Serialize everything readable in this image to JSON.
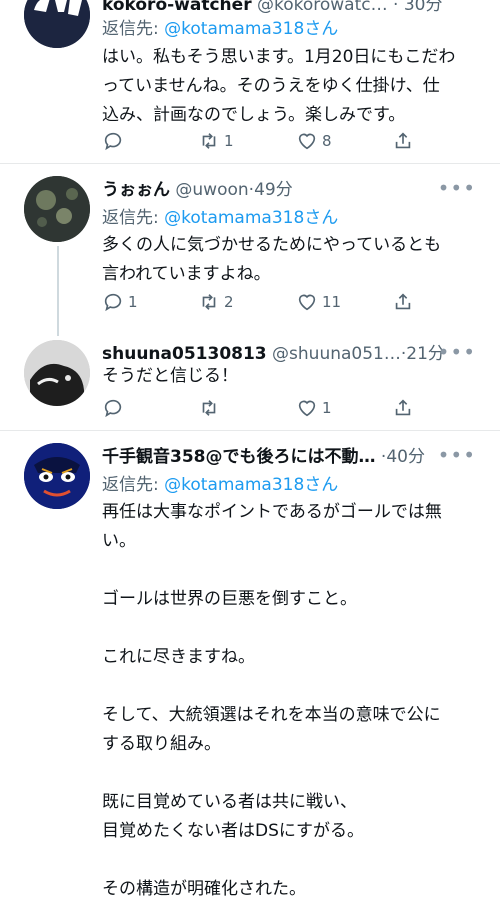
{
  "tweets": [
    {
      "name": "kokoro-watcher",
      "handle": "@kokorowatc…",
      "time": "30分",
      "reply_label": "返信先: ",
      "reply_to": "@kotamama318さん",
      "lines": [
        "はい。私もそう思います。1月20日にもこだわ",
        "っていませんね。そのうえをゆく仕掛け、仕",
        "込み、計画なのでしょう。楽しみです。"
      ],
      "replies": "",
      "retweets": "1",
      "likes": "8"
    },
    {
      "name": "うぉぉん",
      "handle": "@uwoon",
      "time": "49分",
      "reply_label": "返信先: ",
      "reply_to": "@kotamama318さん",
      "lines": [
        "多くの人に気づかせるためにやっているとも",
        "言われていますよね。"
      ],
      "replies": "1",
      "retweets": "2",
      "likes": "11"
    },
    {
      "name": "shuuna05130813",
      "handle": "@shuuna051…",
      "time": "21分",
      "lines": [
        "そうだと信じる！"
      ],
      "replies": "",
      "retweets": "",
      "likes": "1"
    },
    {
      "name": "千手観音358@でも後ろには不動…",
      "handle": "",
      "time": "40分",
      "reply_label": "返信先: ",
      "reply_to": "@kotamama318さん",
      "lines": [
        "再任は大事なポイントであるがゴールでは無",
        "い。",
        "",
        "ゴールは世界の巨悪を倒すこと。",
        "",
        "これに尽きますね。",
        "",
        "そして、大統領選はそれを本当の意味で公に",
        "する取り組み。",
        "",
        "既に目覚めている者は共に戦い、",
        "目覚めたくない者はDSにすがる。",
        "",
        "その構造が明確化された。"
      ]
    }
  ],
  "dot_separator": "·",
  "more_label": "•••"
}
